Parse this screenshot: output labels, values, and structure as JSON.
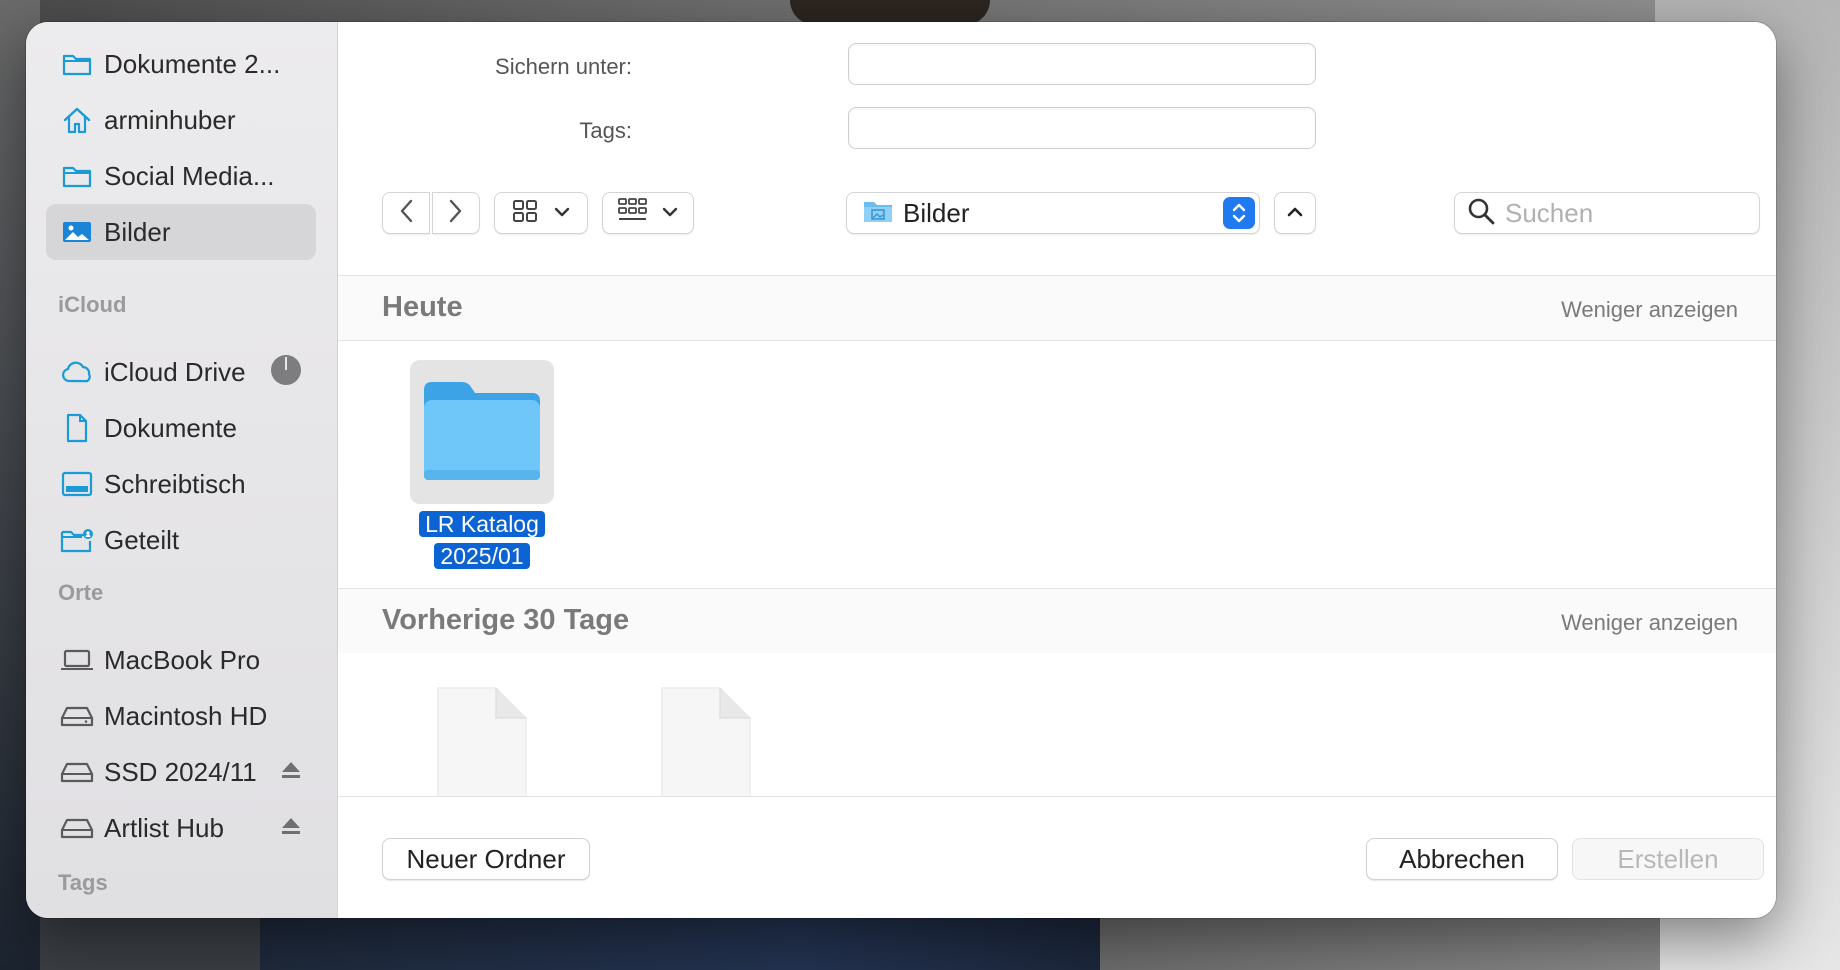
{
  "sidebar": {
    "favorites": [
      {
        "label": "Dokumente 2...",
        "icon": "folder-icon"
      },
      {
        "label": "arminhuber",
        "icon": "home-icon"
      },
      {
        "label": "Social Media...",
        "icon": "folder-icon"
      },
      {
        "label": "Bilder",
        "icon": "photos-icon",
        "selected": true
      }
    ],
    "icloud_title": "iCloud",
    "icloud": [
      {
        "label": "iCloud Drive",
        "icon": "cloud-icon"
      },
      {
        "label": "Dokumente",
        "icon": "document-icon"
      },
      {
        "label": "Schreibtisch",
        "icon": "desktop-icon"
      },
      {
        "label": "Geteilt",
        "icon": "shared-folder-icon"
      }
    ],
    "places_title": "Orte",
    "places": [
      {
        "label": "MacBook Pro",
        "icon": "laptop-icon"
      },
      {
        "label": "Macintosh HD",
        "icon": "disk-icon"
      },
      {
        "label": "SSD 2024/11",
        "icon": "disk-icon",
        "eject": true
      },
      {
        "label": "Artlist Hub",
        "icon": "disk-icon",
        "eject": true
      }
    ],
    "tags_title": "Tags"
  },
  "form": {
    "save_as_label": "Sichern unter:",
    "save_as_value": "",
    "tags_label": "Tags:",
    "tags_value": ""
  },
  "toolbar": {
    "location": "Bilder",
    "search_placeholder": "Suchen"
  },
  "sections": [
    {
      "title": "Heute",
      "link": "Weniger anzeigen"
    },
    {
      "title": "Vorherige 30 Tage",
      "link": "Weniger anzeigen"
    }
  ],
  "files": {
    "selected_folder_line1": "LR Katalog",
    "selected_folder_line2": "2025/01"
  },
  "footer": {
    "new_folder": "Neuer Ordner",
    "cancel": "Abbrechen",
    "create": "Erstellen"
  },
  "colors": {
    "accent": "#1f7af0",
    "selection": "#0b63d4",
    "sidebar_icon": "#1a9bd7"
  }
}
